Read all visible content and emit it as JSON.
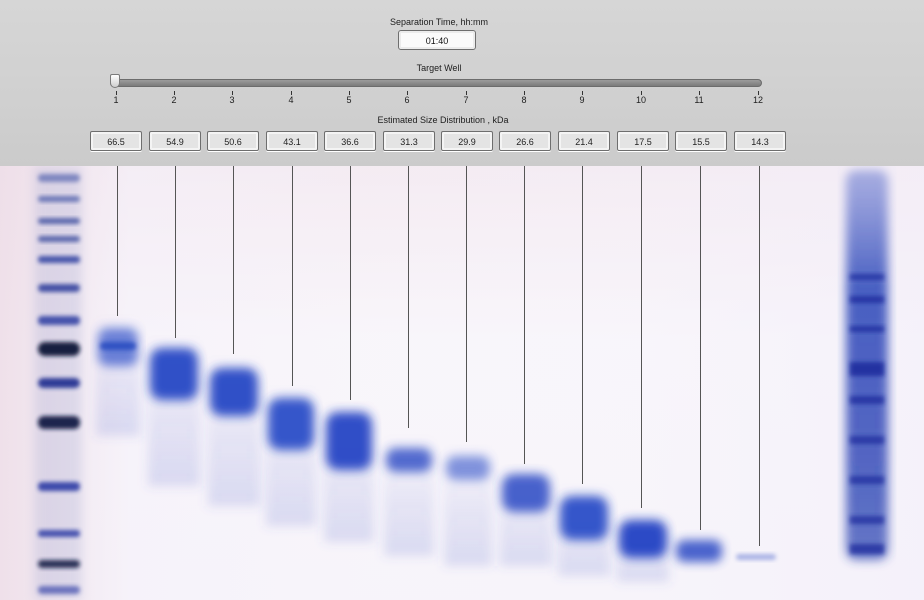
{
  "separation_time": {
    "label": "Separation Time, hh:mm",
    "value": "01:40"
  },
  "target_well": {
    "label": "Target Well",
    "selected_well": 1,
    "ticks": [
      "1",
      "2",
      "3",
      "4",
      "5",
      "6",
      "7",
      "8",
      "9",
      "10",
      "11",
      "12"
    ]
  },
  "size_distribution": {
    "label": "Estimated Size Distribution , kDa",
    "values": [
      "66.5",
      "54.9",
      "50.6",
      "43.1",
      "36.6",
      "31.3",
      "29.9",
      "26.6",
      "21.4",
      "17.5",
      "15.5",
      "14.3"
    ]
  },
  "colors": {
    "band_blue": "#1f3fb8",
    "panel_gray": "#d3d3d3",
    "gel_background": "#f6f2f8"
  }
}
